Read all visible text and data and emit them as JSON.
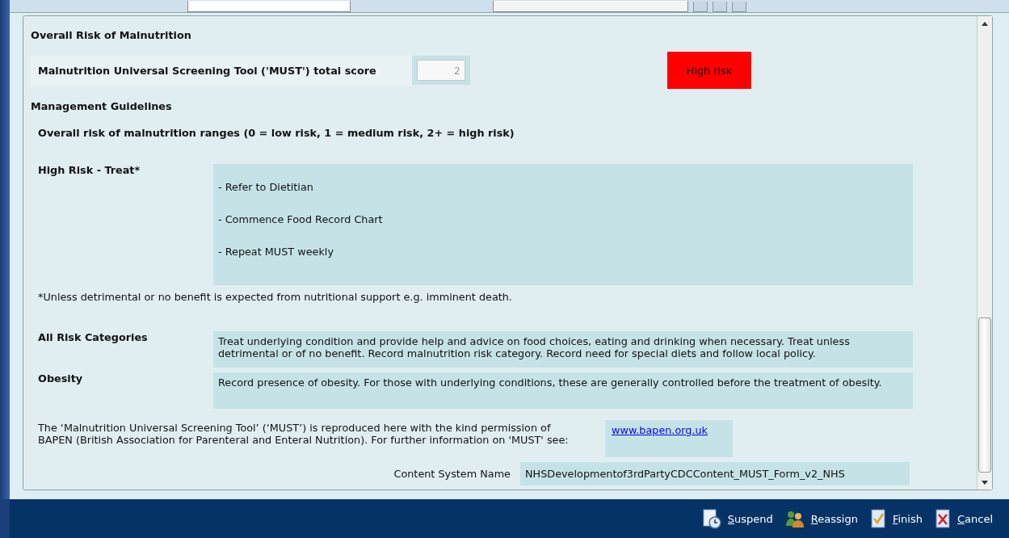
{
  "section_title": "Overall Risk of Malnutrition",
  "score": {
    "label": "Malnutrition Universal Screening Tool ('MUST') total score",
    "value": "2",
    "disabled": true,
    "risk": {
      "label": "High risk",
      "color": "#ff0000"
    }
  },
  "guidelines_title": "Management Guidelines",
  "ranges_text": "Overall risk of malnutrition ranges (0 = low risk, 1 = medium risk, 2+ = high risk)",
  "high_risk": {
    "label": "High Risk - Treat*",
    "items": [
      "- Refer to Dietitian",
      "- Commence Food Record Chart",
      "- Repeat MUST weekly"
    ]
  },
  "footnote": "*Unless detrimental or no benefit is expected from nutritional support e.g. imminent death.",
  "categories": [
    {
      "label": "All Risk Categories",
      "text": "Treat underlying condition and provide help and advice on food choices, eating and drinking when necessary. Treat unless detrimental or of no benefit. Record malnutrition risk category. Record need for special diets and follow local policy."
    },
    {
      "label": "Obesity",
      "text": "Record presence of obesity. For those with underlying conditions, these are generally controlled before the treatment of obesity."
    }
  ],
  "permission": {
    "text": "The ‘Malnutrition Universal Screening Tool’ (‘MUST’) is reproduced here with the kind permission of BAPEN (British Association for Parenteral and Enteral Nutrition). For further information on 'MUST' see:",
    "link": "www.bapen.org.uk"
  },
  "content_system": {
    "label": "Content System Name",
    "value": "NHSDevelopmentof3rdPartyCDCContent_MUST_Form_v2_NHS"
  },
  "actions": [
    {
      "kind": "suspend",
      "label": "Suspend"
    },
    {
      "kind": "reassign",
      "label": "Reassign"
    },
    {
      "kind": "finish",
      "label": "Finish"
    },
    {
      "kind": "cancel",
      "label": "Cancel"
    }
  ]
}
